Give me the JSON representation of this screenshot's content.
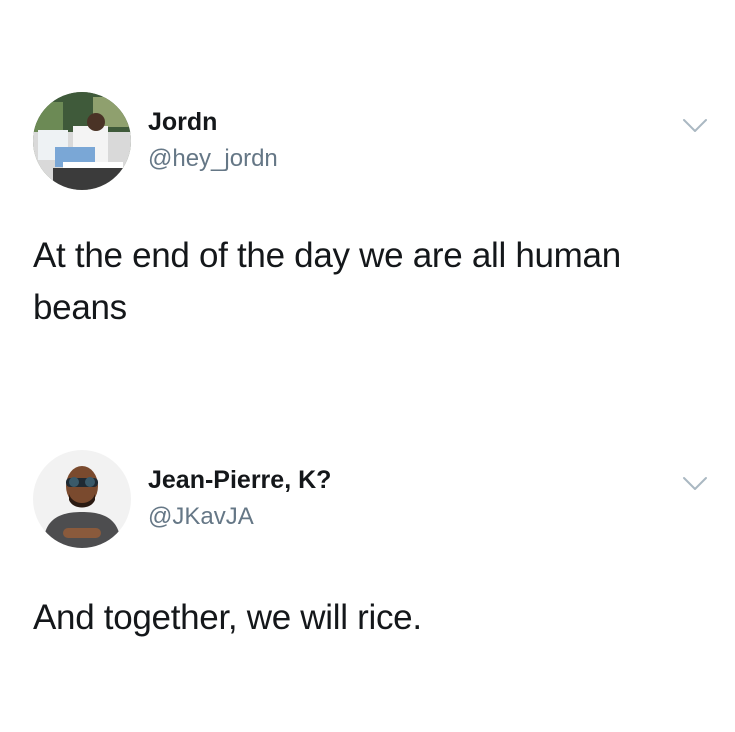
{
  "tweets": [
    {
      "display_name": "Jordn",
      "handle": "@hey_jordn",
      "text": "At the end of the day we are all human beans",
      "avatar_icon": "user-avatar-photo",
      "menu_icon": "chevron-down-icon"
    },
    {
      "display_name": "Jean-Pierre, K?",
      "handle": "@JKavJA",
      "text": "And together, we will rice.",
      "avatar_icon": "user-avatar-photo",
      "menu_icon": "chevron-down-icon"
    }
  ],
  "colors": {
    "text": "#14171a",
    "handle": "#657786",
    "chevron": "#aab8c2",
    "background": "#ffffff"
  }
}
